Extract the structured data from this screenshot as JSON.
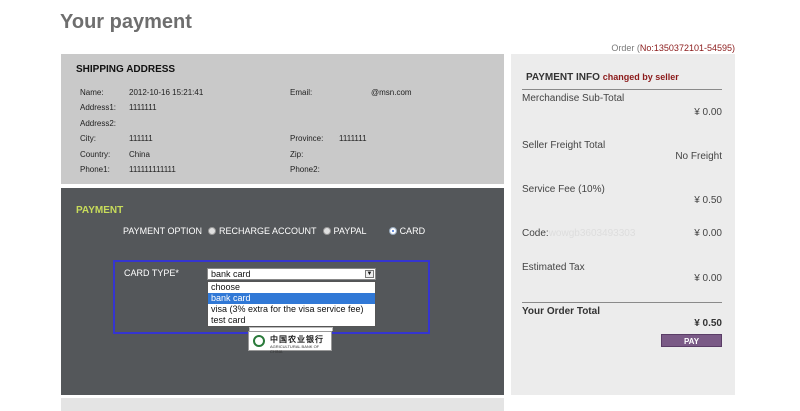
{
  "page": {
    "title": "Your payment"
  },
  "order": {
    "prefix": "Order (",
    "number": "No:1350372101-54595)"
  },
  "shipping": {
    "heading": "SHIPPING ADDRESS",
    "name_label": "Name:",
    "name_value": "2012-10-16 15:21:41",
    "email_label": "Email:",
    "email_value": "@msn.com",
    "address1_label": "Address1:",
    "address1_value": "1111111",
    "address2_label": "Address2:",
    "address2_value": "",
    "city_label": "City:",
    "city_value": "111111",
    "province_label": "Province:",
    "province_value": "1111111",
    "country_label": "Country:",
    "country_value": "China",
    "zip_label": "Zip:",
    "zip_value": "",
    "phone1_label": "Phone1:",
    "phone1_value": "111111111111",
    "phone2_label": "Phone2:",
    "phone2_value": ""
  },
  "payment": {
    "heading": "PAYMENT",
    "option_label": "PAYMENT OPTION",
    "options": [
      {
        "label": "RECHARGE ACCOUNT",
        "selected": false
      },
      {
        "label": "PAYPAL",
        "selected": false
      },
      {
        "label": "CARD",
        "selected": true
      }
    ],
    "card_type_label": "CARD TYPE*",
    "card_type_value": "bank card",
    "card_type_options": [
      "choose",
      "bank card",
      "visa (3% extra for the visa service fee)",
      "test card"
    ],
    "card_type_highlighted": "bank card",
    "bank_logo": {
      "cn": "中国农业银行",
      "en": "AGRICULTURAL BANK OF CHINA"
    }
  },
  "info": {
    "heading": "PAYMENT INFO",
    "changed": "changed by seller",
    "subtotal_label": "Merchandise Sub-Total",
    "subtotal_value": "¥ 0.00",
    "freight_label": "Seller Freight Total",
    "freight_value": "No Freight",
    "service_label": "Service Fee (10%)",
    "service_value": "¥ 0.50",
    "code_label": "Code:",
    "code_value": "wowgb3603493303",
    "code_amount": "¥ 0.00",
    "tax_label": "Estimated Tax",
    "tax_value": "¥ 0.00",
    "total_label": "Your Order Total",
    "total_value": "¥ 0.50",
    "pay_button": "PAY"
  },
  "colors": {
    "accent_green": "#c8dc5a",
    "pay_button": "#7a5a86",
    "highlight_blue": "#3078d6",
    "focus_border": "#3535d0"
  }
}
